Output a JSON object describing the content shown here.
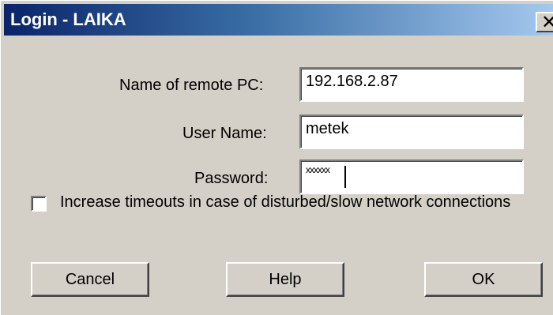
{
  "window": {
    "title": "Login - LAIKA",
    "close_glyph": "✕"
  },
  "form": {
    "remote_pc_label": "Name of remote PC:",
    "remote_pc_value": "192.168.2.87",
    "user_name_label": "User Name:",
    "user_name_value": "metek",
    "password_label": "Password:",
    "password_masked": "xxxxxx"
  },
  "options": {
    "timeout_checkbox_label": "Increase timeouts in case of disturbed/slow network connections",
    "timeout_checkbox_checked": false
  },
  "buttons": {
    "cancel": "Cancel",
    "help": "Help",
    "ok": "OK"
  },
  "colors": {
    "titlebar_start": "#0a246a",
    "titlebar_end": "#a6caf0",
    "face": "#d4d0c8"
  },
  "icons": {
    "close": "close-icon"
  }
}
